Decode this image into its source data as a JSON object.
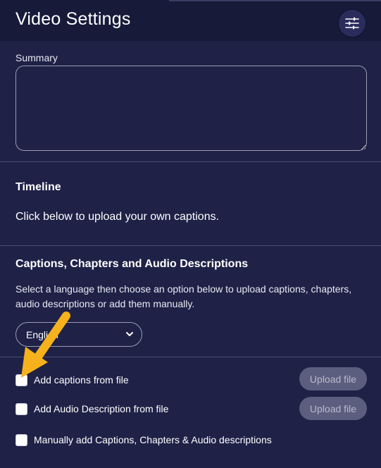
{
  "header": {
    "title": "Video Settings",
    "settings_icon": "sliders-icon"
  },
  "summary": {
    "label": "Summary",
    "value": ""
  },
  "timeline": {
    "title": "Timeline",
    "text": "Click below to upload your own captions."
  },
  "captions": {
    "title": "Captions, Chapters and Audio Descriptions",
    "description": "Select a language then choose an option below to upload captions, chapters, audio descriptions or add them manually.",
    "language": "English"
  },
  "options": [
    {
      "label": "Add captions from file",
      "button": "Upload file",
      "checked": false
    },
    {
      "label": "Add Audio Description from file",
      "button": "Upload file",
      "checked": false
    },
    {
      "label": "Manually add Captions, Chapters & Audio descriptions",
      "checked": false
    }
  ],
  "colors": {
    "background": "#1f2147",
    "header": "#181a3a",
    "arrow": "#f5b21c",
    "button_disabled": "#5c5e7f"
  }
}
